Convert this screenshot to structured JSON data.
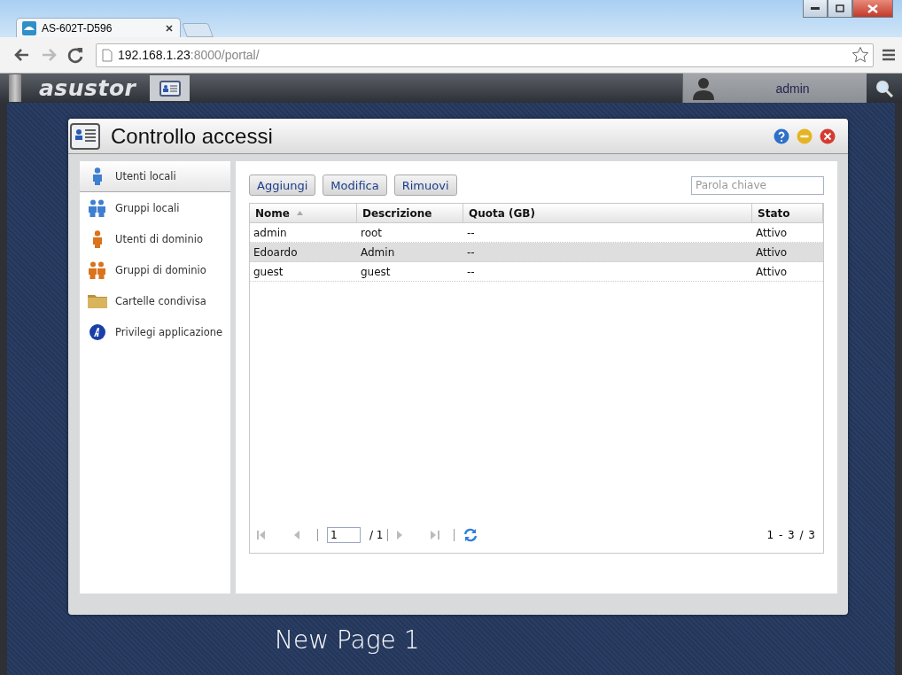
{
  "browser": {
    "tab_title": "AS-602T-D596",
    "url_host": "192.168.1.23",
    "url_rest": ":8000/portal/"
  },
  "app_bar": {
    "logo": "asustor",
    "user": "admin"
  },
  "window": {
    "title": "Controllo accessi"
  },
  "sidebar": {
    "items": [
      {
        "label": "Utenti locali",
        "kind": "local-user",
        "selected": true
      },
      {
        "label": "Gruppi locali",
        "kind": "local-group",
        "selected": false
      },
      {
        "label": "Utenti di dominio",
        "kind": "domain-user",
        "selected": false
      },
      {
        "label": "Gruppi di dominio",
        "kind": "domain-group",
        "selected": false
      },
      {
        "label": "Cartelle condivisa",
        "kind": "folder",
        "selected": false
      },
      {
        "label": "Privilegi applicazione",
        "kind": "app",
        "selected": false
      }
    ]
  },
  "toolbar": {
    "buttons": [
      "Aggiungi",
      "Modifica",
      "Rimuovi"
    ],
    "search": {
      "placeholder": "Parola chiave"
    }
  },
  "table": {
    "columns": [
      {
        "label": "Nome",
        "sorted": true
      },
      {
        "label": "Descrizione",
        "sorted": false
      },
      {
        "label": "Quota (GB)",
        "sorted": false
      },
      {
        "label": "Stato",
        "sorted": false
      }
    ],
    "rows": [
      {
        "cells": [
          "admin",
          "root",
          "--",
          "Attivo"
        ],
        "selected": false
      },
      {
        "cells": [
          "Edoardo",
          "Admin",
          "--",
          "Attivo"
        ],
        "selected": true
      },
      {
        "cells": [
          "guest",
          "guest",
          "--",
          "Attivo"
        ],
        "selected": false
      }
    ]
  },
  "pager": {
    "page": "1",
    "total": "/ 1",
    "range": "1 - 3 / 3"
  },
  "desktop": {
    "page_label": "New Page 1"
  }
}
